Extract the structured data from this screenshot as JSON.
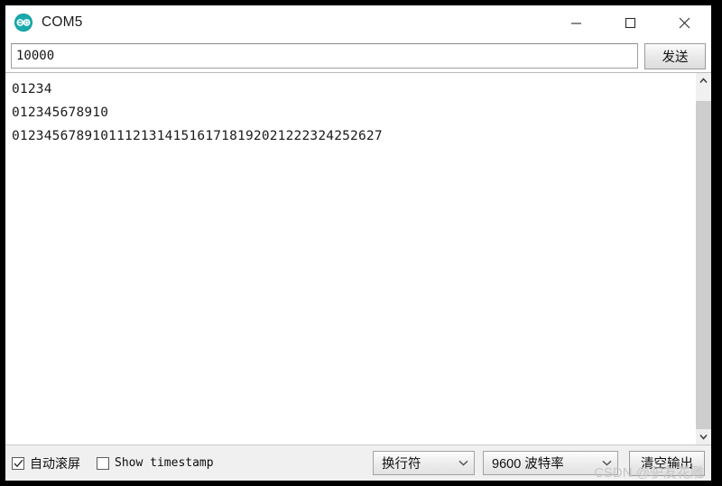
{
  "window": {
    "title": "COM5",
    "app_icon": "arduino-icon",
    "controls": {
      "minimize": "minimize-icon",
      "maximize": "maximize-icon",
      "close": "close-icon"
    }
  },
  "send_row": {
    "input_value": "10000",
    "input_placeholder": "",
    "send_label": "发送"
  },
  "output": {
    "lines": [
      "01234",
      "012345678910",
      "0123456789101112131415161718192021222324252627"
    ]
  },
  "scrollbar": {
    "up_icon": "chevron-up-icon",
    "down_icon": "chevron-down-icon"
  },
  "bottom_bar": {
    "autoscroll": {
      "label": "自动滚屏",
      "checked": true,
      "check_mark": "✓"
    },
    "timestamp": {
      "label": "Show timestamp",
      "checked": false,
      "check_mark": ""
    },
    "newline_select": {
      "value": "换行符",
      "arrow_icon": "chevron-down-icon"
    },
    "baud_select": {
      "value": "9600 波特率",
      "arrow_icon": "chevron-down-icon"
    },
    "clear_label": "清空输出"
  },
  "watermark": {
    "text": "CSDN @驴友花雕"
  },
  "colors": {
    "accent": "#00979c",
    "window_bg": "#ffffff",
    "chrome_bg": "#f0f0f0",
    "text": "#101010",
    "scroll_thumb": "#cdcdcd"
  }
}
